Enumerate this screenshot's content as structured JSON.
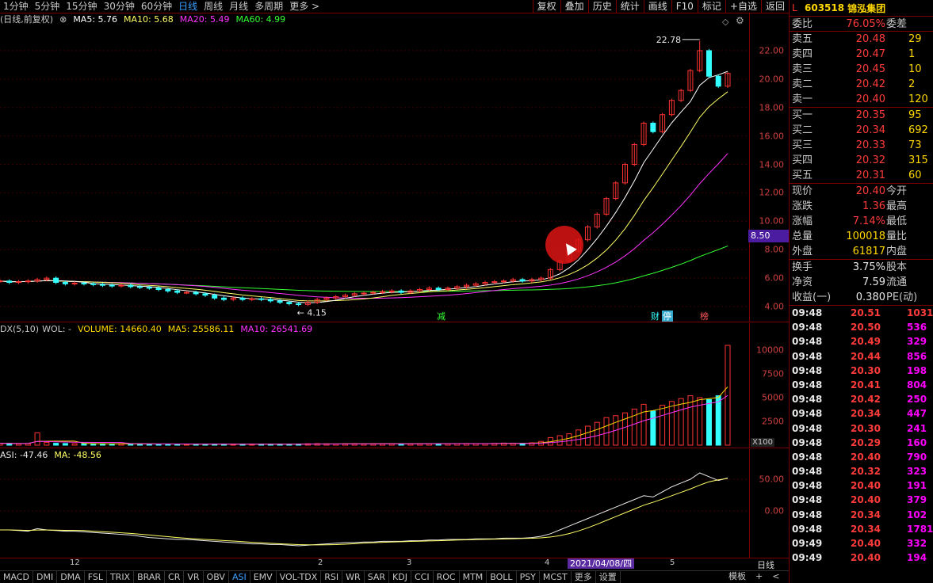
{
  "toolbar": {
    "periods": [
      "1分钟",
      "5分钟",
      "15分钟",
      "30分钟",
      "60分钟",
      "日线",
      "周线",
      "月线",
      "多周期",
      "更多 >"
    ],
    "active_period": "日线",
    "actions": [
      "复权",
      "叠加",
      "历史",
      "统计",
      "画线",
      "F10",
      "标记",
      "+自选",
      "返回"
    ]
  },
  "main_legend": {
    "title": "(日线,前复权)",
    "ma5": "MA5: 5.76",
    "ma10": "MA10: 5.68",
    "ma20": "MA20: 5.49",
    "ma60": "MA60: 4.99"
  },
  "main_axis": [
    "22.00",
    "20.00",
    "18.00",
    "16.00",
    "14.00",
    "12.00",
    "10.00",
    "8.00",
    "6.00",
    "4.00"
  ],
  "annotations": {
    "high": "22.78",
    "low": "4.15",
    "marker_jian": "减",
    "marker_cai": "财",
    "marker_ting": "停",
    "marker_bang": "榜",
    "price_flag": "8.50"
  },
  "vol_legend": {
    "title": "DX(5,10)",
    "wol": "WOL: -",
    "volume": "VOLUME: 14660.40",
    "ma5": "MA5: 25586.11",
    "ma10": "MA10: 26541.69"
  },
  "vol_axis": [
    "10000",
    "7500",
    "5000",
    "2500"
  ],
  "vol_unit": "X100",
  "asi_legend": {
    "asi": "ASI: -47.46",
    "ma": "MA: -48.56"
  },
  "asi_axis": [
    "50.00",
    "0.00"
  ],
  "date_axis": [
    "12",
    "2",
    "3",
    "4",
    "5"
  ],
  "date_badge": "2021/04/08/四",
  "period_label": "日线",
  "tabs": [
    "MACD",
    "DMI",
    "DMA",
    "FSL",
    "TRIX",
    "BRAR",
    "CR",
    "VR",
    "OBV",
    "ASI",
    "EMV",
    "VOL-TDX",
    "RSI",
    "WR",
    "SAR",
    "KDJ",
    "CCI",
    "ROC",
    "MTM",
    "BOLL",
    "PSY",
    "MCST",
    "更多",
    "设置"
  ],
  "active_tab": "ASI",
  "tabs_right": [
    "模板",
    "+",
    "<"
  ],
  "stock": {
    "marker": "L",
    "code": "603518",
    "name": "锦泓集团"
  },
  "order_ratio": {
    "k": "委比",
    "v": "76.05%",
    "k2": "委差"
  },
  "asks": [
    {
      "label": "卖五",
      "price": "20.48",
      "qty": "29"
    },
    {
      "label": "卖四",
      "price": "20.47",
      "qty": "1"
    },
    {
      "label": "卖三",
      "price": "20.45",
      "qty": "10"
    },
    {
      "label": "卖二",
      "price": "20.42",
      "qty": "2"
    },
    {
      "label": "卖一",
      "price": "20.40",
      "qty": "120"
    }
  ],
  "bids": [
    {
      "label": "买一",
      "price": "20.35",
      "qty": "95"
    },
    {
      "label": "买二",
      "price": "20.34",
      "qty": "692"
    },
    {
      "label": "买三",
      "price": "20.33",
      "qty": "73"
    },
    {
      "label": "买四",
      "price": "20.32",
      "qty": "315"
    },
    {
      "label": "买五",
      "price": "20.31",
      "qty": "60"
    }
  ],
  "quote": [
    {
      "k": "现价",
      "v": "20.40",
      "k2": "今开"
    },
    {
      "k": "涨跌",
      "v": "1.36",
      "k2": "最高"
    },
    {
      "k": "涨幅",
      "v": "7.14%",
      "k2": "最低"
    },
    {
      "k": "总量",
      "v": "100018",
      "k2": "量比"
    },
    {
      "k": "外盘",
      "v": "61817",
      "k2": "内盘"
    }
  ],
  "fundamentals": [
    {
      "k": "换手",
      "v": "3.75%",
      "k2": "股本"
    },
    {
      "k": "净资",
      "v": "7.59",
      "k2": "流通"
    },
    {
      "k": "收益(一)",
      "v": "0.380",
      "k2": "PE(动)"
    }
  ],
  "ticks": [
    {
      "t": "09:48",
      "p": "20.51",
      "q": "1031",
      "side": "sell"
    },
    {
      "t": "09:48",
      "p": "20.50",
      "q": "536",
      "side": "buy"
    },
    {
      "t": "09:48",
      "p": "20.49",
      "q": "329",
      "side": "buy"
    },
    {
      "t": "09:48",
      "p": "20.44",
      "q": "856",
      "side": "buy"
    },
    {
      "t": "09:48",
      "p": "20.30",
      "q": "198",
      "side": "buy"
    },
    {
      "t": "09:48",
      "p": "20.41",
      "q": "804",
      "side": "buy"
    },
    {
      "t": "09:48",
      "p": "20.42",
      "q": "250",
      "side": "buy"
    },
    {
      "t": "09:48",
      "p": "20.34",
      "q": "447",
      "side": "buy"
    },
    {
      "t": "09:48",
      "p": "20.30",
      "q": "241",
      "side": "buy"
    },
    {
      "t": "09:48",
      "p": "20.29",
      "q": "160",
      "side": "buy"
    },
    {
      "t": "09:48",
      "p": "20.40",
      "q": "790",
      "side": "buy"
    },
    {
      "t": "09:48",
      "p": "20.32",
      "q": "323",
      "side": "buy"
    },
    {
      "t": "09:48",
      "p": "20.40",
      "q": "191",
      "side": "buy"
    },
    {
      "t": "09:48",
      "p": "20.40",
      "q": "379",
      "side": "buy"
    },
    {
      "t": "09:48",
      "p": "20.34",
      "q": "102",
      "side": "buy"
    },
    {
      "t": "09:48",
      "p": "20.34",
      "q": "1781",
      "side": "buy"
    },
    {
      "t": "09:49",
      "p": "20.40",
      "q": "332",
      "side": "buy"
    },
    {
      "t": "09:49",
      "p": "20.40",
      "q": "194",
      "side": "buy"
    }
  ],
  "colors": {
    "ma5": "#ffffff",
    "ma10": "#ffff66",
    "ma20": "#ff33ff",
    "ma60": "#33ff33",
    "up": "#ff3333",
    "down": "#33ffff",
    "border": "#7a0000"
  },
  "chart_data": {
    "type": "candlestick",
    "price_series_close": [
      5.8,
      5.7,
      5.75,
      5.8,
      5.9,
      6.0,
      5.7,
      5.6,
      5.65,
      5.6,
      5.55,
      5.5,
      5.45,
      5.5,
      5.4,
      5.35,
      5.3,
      5.2,
      5.1,
      5.0,
      5.0,
      4.9,
      4.8,
      4.6,
      4.5,
      4.6,
      4.5,
      4.55,
      4.5,
      4.4,
      4.3,
      4.2,
      4.15,
      4.3,
      4.5,
      4.6,
      4.7,
      4.8,
      4.9,
      4.95,
      5.0,
      5.05,
      5.1,
      5.0,
      5.1,
      5.2,
      5.3,
      5.2,
      5.3,
      5.4,
      5.5,
      5.6,
      5.7,
      5.75,
      5.8,
      5.9,
      5.8,
      5.9,
      6.0,
      6.6,
      7.2,
      7.9,
      8.7,
      9.6,
      10.5,
      11.6,
      12.7,
      14.0,
      15.4,
      16.9,
      16.3,
      17.5,
      18.5,
      19.2,
      20.6,
      22.0,
      20.2,
      19.5,
      20.4
    ],
    "volume_x100": [
      200,
      180,
      150,
      170,
      1300,
      300,
      200,
      180,
      160,
      150,
      150,
      140,
      130,
      150,
      140,
      130,
      120,
      110,
      100,
      100,
      100,
      110,
      100,
      120,
      110,
      100,
      100,
      110,
      100,
      100,
      110,
      100,
      120,
      150,
      160,
      140,
      130,
      150,
      160,
      140,
      150,
      160,
      150,
      140,
      150,
      160,
      170,
      150,
      160,
      170,
      180,
      170,
      160,
      190,
      220,
      200,
      180,
      250,
      400,
      800,
      1000,
      1200,
      1600,
      2000,
      2400,
      2900,
      3100,
      3400,
      3800,
      4300,
      3600,
      4200,
      4600,
      4900,
      5200,
      5000,
      4800,
      5200,
      10500
    ],
    "asi_series": [
      -30,
      -30,
      -31,
      -32,
      -28,
      -30,
      -31,
      -32,
      -32,
      -33,
      -34,
      -35,
      -36,
      -37,
      -38,
      -40,
      -42,
      -43,
      -44,
      -45,
      -45,
      -46,
      -47,
      -48,
      -49,
      -50,
      -51,
      -52,
      -52,
      -53,
      -53,
      -54,
      -55,
      -54,
      -53,
      -52,
      -51,
      -50,
      -50,
      -49,
      -49,
      -48,
      -48,
      -48,
      -47,
      -47,
      -46,
      -46,
      -45,
      -45,
      -45,
      -44,
      -44,
      -44,
      -43,
      -43,
      -43,
      -42,
      -40,
      -36,
      -30,
      -24,
      -18,
      -12,
      -6,
      0,
      6,
      12,
      18,
      24,
      22,
      30,
      38,
      44,
      50,
      60,
      54,
      48,
      52
    ]
  }
}
